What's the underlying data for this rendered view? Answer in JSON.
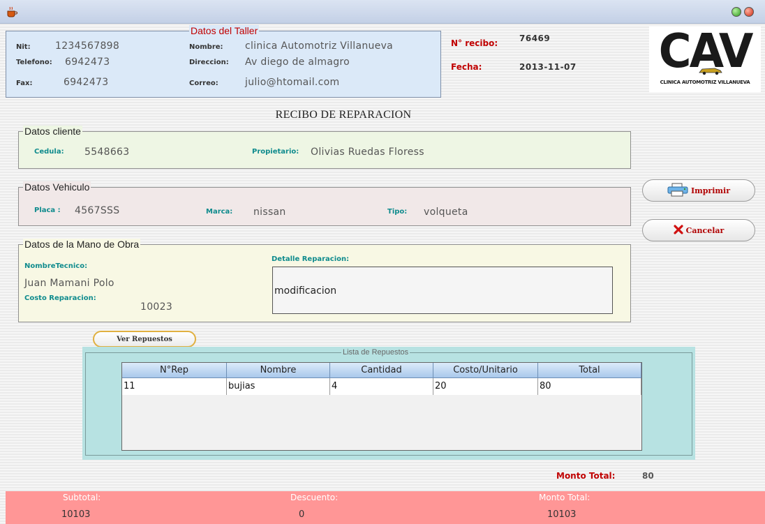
{
  "taller": {
    "legend": "Datos del Taller",
    "nit_label": "Nit:",
    "nit": "1234567898",
    "telefono_label": "Telefono:",
    "telefono": "6942473",
    "fax_label": "Fax:",
    "fax": "6942473",
    "nombre_label": "Nombre:",
    "nombre": "clinica Automotriz Villanueva",
    "direccion_label": "Direccion:",
    "direccion": "Av diego de almagro",
    "correo_label": "Correo:",
    "correo": "julio@htomail.com"
  },
  "recibo": {
    "numero_label": "N° recibo:",
    "numero": "76469",
    "fecha_label": "Fecha:",
    "fecha": "2013-11-07"
  },
  "logo": {
    "text": "CAV",
    "subtitle": "CLINICA AUTOMOTRIZ VILLANUEVA"
  },
  "title": "RECIBO DE REPARACION",
  "cliente": {
    "legend": "Datos cliente",
    "cedula_label": "Cedula:",
    "cedula": "5548663",
    "propietario_label": "Propietario:",
    "propietario": "Olivias Ruedas Floress"
  },
  "vehiculo": {
    "legend": "Datos Vehiculo",
    "placa_label": "Placa :",
    "placa": "4567SSS",
    "marca_label": "Marca:",
    "marca": "nissan",
    "tipo_label": "Tipo:",
    "tipo": "volqueta"
  },
  "mano_obra": {
    "legend": "Datos de la Mano de Obra",
    "tecnico_label": "NombreTecnico:",
    "tecnico": "Juan Mamani Polo",
    "costo_label": "Costo Reparacion:",
    "costo": "10023",
    "detalle_label": "Detalle Reparacion:",
    "detalle": "modificacion"
  },
  "buttons": {
    "imprimir": "Imprimir",
    "cancelar": "Cancelar",
    "ver_repuestos": "Ver Repuestos"
  },
  "repuestos": {
    "legend": "Lista de Repuestos",
    "columns": [
      "N°Rep",
      "Nombre",
      "Cantidad",
      "Costo/Unitario",
      "Total"
    ],
    "rows": [
      [
        "11",
        "bujias",
        "4",
        "20",
        "80"
      ]
    ]
  },
  "monto": {
    "label": "Monto Total:",
    "value": "80"
  },
  "footer": {
    "subtotal_label": "Subtotal:",
    "subtotal": "10103",
    "descuento_label": "Descuento:",
    "descuento": "0",
    "monto_total_label": "Monto Total:",
    "monto_total": "10103"
  },
  "colors": {
    "accent_red": "#c00000",
    "teal_label": "#0f8b8d",
    "footer_bg": "#ff9696"
  }
}
